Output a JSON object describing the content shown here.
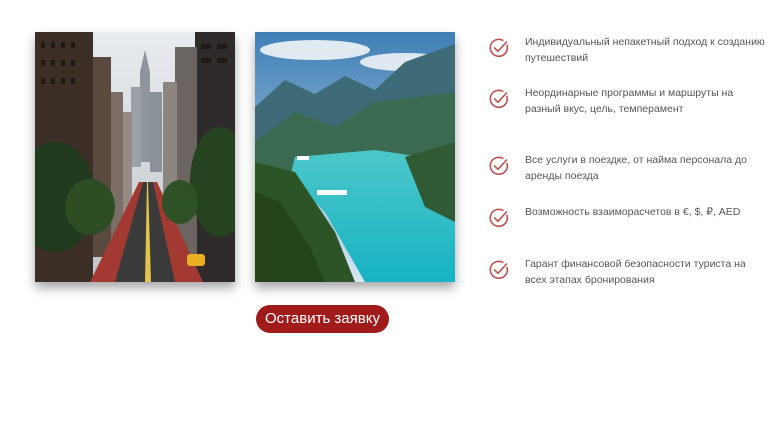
{
  "images": {
    "city": {
      "alt": "city-street"
    },
    "fjord": {
      "alt": "fjord-landscape"
    }
  },
  "cta": {
    "label": "Оставить заявку",
    "color": "#a21b1b"
  },
  "features": [
    {
      "icon": "check-circle-icon",
      "text": "Индивидуальный непакетный подход к созданию путешествий"
    },
    {
      "icon": "check-circle-icon",
      "text": "Неординарные программы и маршруты на разный вкус, цель, темперамент"
    },
    {
      "icon": "check-circle-icon",
      "text": "Все услуги в поездке, от найма персонала до аренды поезда"
    },
    {
      "icon": "check-circle-icon",
      "text": "Возможность взаиморасчетов в €, $, ₽, AED"
    },
    {
      "icon": "check-circle-icon",
      "text": "Гарант финансовой безопасности туриста на всех этапах бронирования"
    }
  ],
  "colors": {
    "accent": "#c0504d",
    "text": "#555555"
  }
}
